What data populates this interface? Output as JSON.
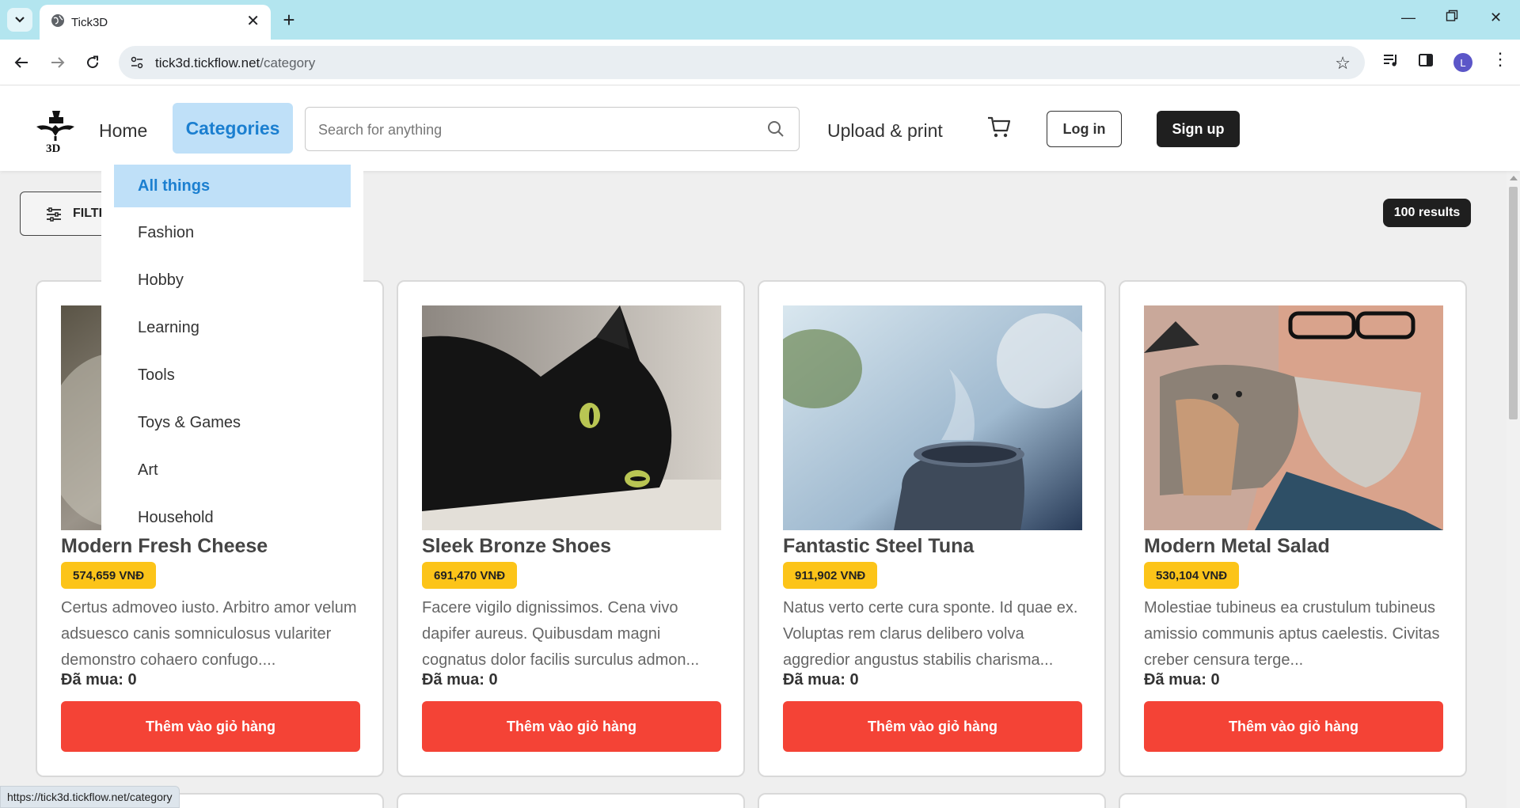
{
  "browser": {
    "tab_title": "Tick3D",
    "url_host": "tick3d.tickflow.net",
    "url_path": "/category",
    "avatar_initial": "L",
    "status_url": "https://tick3d.tickflow.net/category"
  },
  "header": {
    "logo_text": "3D",
    "home": "Home",
    "categories": "Categories",
    "search_placeholder": "Search for anything",
    "upload": "Upload & print",
    "login": "Log in",
    "signup": "Sign up"
  },
  "dropdown": {
    "items": [
      "All things",
      "Fashion",
      "Hobby",
      "Learning",
      "Tools",
      "Toys & Games",
      "Art",
      "Household"
    ],
    "active_index": 0
  },
  "controls": {
    "filter_label": "FILTER",
    "results": "100 results"
  },
  "products": [
    {
      "name": "Modern Fresh Cheese",
      "price": "574,659 VNĐ",
      "desc": "Certus admoveo iusto. Arbitro amor velum adsuesco canis somniculosus vulariter demonstro cohaero confugo....",
      "bought": "Đã mua: 0",
      "button": "Thêm vào giỏ hàng",
      "image": "cat-photo"
    },
    {
      "name": "Sleek Bronze Shoes",
      "price": "691,470 VNĐ",
      "desc": "Facere vigilo dignissimos. Cena vivo dapifer aureus. Quibusdam magni cognatus dolor facilis surculus admon...",
      "bought": "Đã mua: 0",
      "button": "Thêm vào giỏ hàng",
      "image": "black-cat-photo"
    },
    {
      "name": "Fantastic Steel Tuna",
      "price": "911,902 VNĐ",
      "desc": "Natus verto certe cura sponte. Id quae ex. Voluptas rem clarus delibero volva aggredior angustus stabilis charisma...",
      "bought": "Đã mua: 0",
      "button": "Thêm vào giỏ hàng",
      "image": "steaming-cup-photo"
    },
    {
      "name": "Modern Metal Salad",
      "price": "530,104 VNĐ",
      "desc": "Molestiae tubineus ea crustulum tubineus amissio communis aptus caelestis. Civitas creber censura terge...",
      "bought": "Đã mua: 0",
      "button": "Thêm vào giỏ hàng",
      "image": "man-with-kitten-photo"
    }
  ],
  "colors": {
    "accent_blue": "#1b7fd0",
    "accent_blue_bg": "#bfe0f8",
    "price_badge": "#fcc419",
    "add_button": "#f44336",
    "dark_button": "#1f1f1f"
  }
}
